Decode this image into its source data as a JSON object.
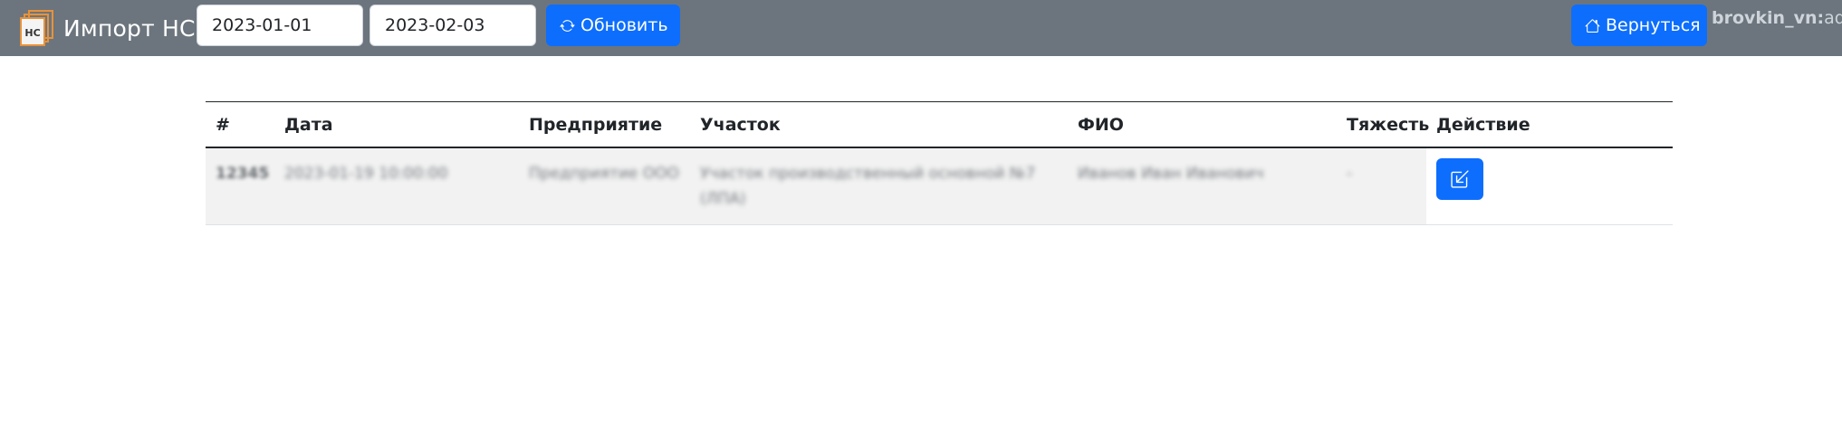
{
  "navbar": {
    "brand_logo_text": "НС",
    "brand_title": "Импорт НС",
    "date_from": "2023-01-01",
    "date_to": "2023-02-03",
    "refresh_label": "Обновить",
    "back_label": "Вернуться",
    "user_name": "brovkin_vn",
    "user_separator": ":",
    "user_role": "adm"
  },
  "table": {
    "headers": {
      "num": "#",
      "date": "Дата",
      "enterprise": "Предприятие",
      "section": "Участок",
      "fio": "ФИО",
      "severity": "Тяжесть",
      "action": "Действие"
    },
    "rows": [
      {
        "num": "12345",
        "date": "2023-01-19 10:00:00",
        "enterprise": "Предприятие ООО",
        "section": "Участок производственный основной №7 (ЛПА)",
        "fio": "Иванов Иван Иванович",
        "severity": "-"
      }
    ]
  },
  "colors": {
    "navbar_bg": "#6c757d",
    "primary": "#0d6efd",
    "logo_orange": "#e8923a",
    "row_stripe": "#f2f2f2"
  },
  "icons": {
    "refresh": "arrow-repeat-icon",
    "back": "house-icon",
    "action": "box-arrow-in-down-left-icon",
    "logo": "stacked-pages-logo"
  }
}
